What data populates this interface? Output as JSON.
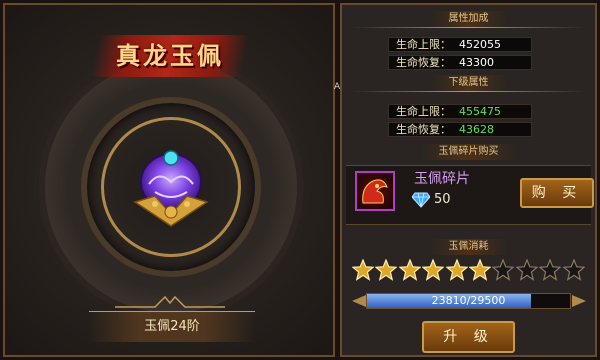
{
  "left": {
    "title": "真龙玉佩",
    "level_label": "玉佩24阶"
  },
  "right": {
    "attr_header": "属性加成",
    "current_stats": [
      {
        "label": "生命上限：",
        "value": "452055"
      },
      {
        "label": "生命恢复：",
        "value": "43300"
      }
    ],
    "next_header": "下级属性",
    "next_stats": [
      {
        "label": "生命上限：",
        "value": "455475"
      },
      {
        "label": "生命恢复：",
        "value": "43628"
      }
    ],
    "shop_header": "玉佩碎片购买",
    "shop": {
      "item_name": "玉佩碎片",
      "price": "50",
      "buy_label": "购 买"
    },
    "consume_header": "玉佩消耗",
    "stars": {
      "filled": 6,
      "total": 10
    },
    "progress": {
      "current": 23810,
      "max": 29500,
      "text": "23810/29500"
    },
    "upgrade_label": "升 级"
  },
  "side_marker": "A",
  "colors": {
    "gold": "#c49a55",
    "stat_value_current": "#ffffff",
    "stat_value_next": "#5fe05a",
    "item_name": "#d79df0",
    "progress_fill": "#2f5fc0",
    "star_filled": "#e0a62a"
  }
}
